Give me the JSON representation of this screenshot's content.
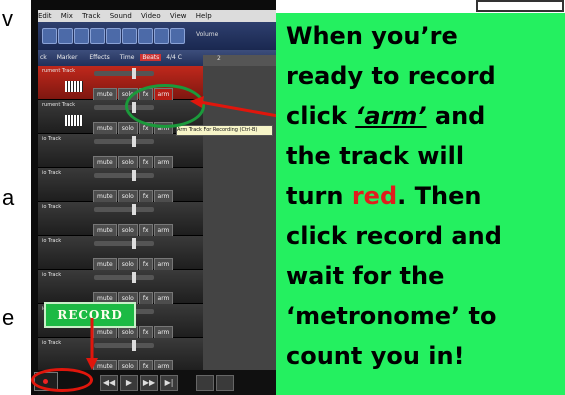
{
  "slide": {
    "left_fragments": [
      "v",
      "a",
      "e"
    ]
  },
  "app": {
    "menu": [
      "Edit",
      "Mix",
      "Track",
      "Sound",
      "Video",
      "View",
      "Help"
    ],
    "volume_label": "Volume",
    "filter_bar": {
      "left": "ck",
      "markers": "Marker",
      "effects": "Effects",
      "time": "Time",
      "beats": "Beats",
      "meter": "4/4 C"
    },
    "ruler_mark": "2",
    "tracks": [
      {
        "name": "rument Track",
        "armed": true,
        "buttons": [
          "mute",
          "solo",
          "fx",
          "arm"
        ]
      },
      {
        "name": "rument Track",
        "armed": false,
        "buttons": [
          "mute",
          "solo",
          "fx",
          "arm"
        ]
      },
      {
        "name": "io Track",
        "armed": false,
        "buttons": [
          "mute",
          "solo",
          "fx",
          "arm"
        ]
      },
      {
        "name": "io Track",
        "armed": false,
        "buttons": [
          "mute",
          "solo",
          "fx",
          "arm"
        ]
      },
      {
        "name": "io Track",
        "armed": false,
        "buttons": [
          "mute",
          "solo",
          "fx",
          "arm"
        ]
      },
      {
        "name": "io Track",
        "armed": false,
        "buttons": [
          "mute",
          "solo",
          "fx",
          "arm"
        ]
      },
      {
        "name": "io Track",
        "armed": false,
        "buttons": [
          "mute",
          "solo",
          "fx",
          "arm"
        ]
      },
      {
        "name": "io Track",
        "armed": false,
        "buttons": [
          "mute",
          "solo",
          "fx",
          "arm"
        ]
      },
      {
        "name": "io Track",
        "armed": false,
        "buttons": [
          "mute",
          "solo",
          "fx",
          "arm"
        ]
      }
    ],
    "tooltip": "Arm Track For Recording (Ctrl-B)",
    "transport": [
      "◀◀",
      "▶",
      "▶▶",
      "▶|"
    ],
    "record_callout": "RECORD"
  },
  "instructions": {
    "line1": "When you’re",
    "line2": "ready to record",
    "line3_pre": "click ",
    "line3_arm": "‘arm’",
    "line3_post": " and",
    "line4": "the track will",
    "line5_pre": "turn ",
    "line5_red": "red",
    "line5_post": ". Then",
    "line6": "click record and",
    "line7": "wait for the",
    "line8": "‘metronome’ to",
    "line9": "count you in!"
  },
  "colors": {
    "panel": "#24f060",
    "armed_track": "#c0281c",
    "record_circle": "#e0160c",
    "arm_circle": "#1b9a3b"
  }
}
